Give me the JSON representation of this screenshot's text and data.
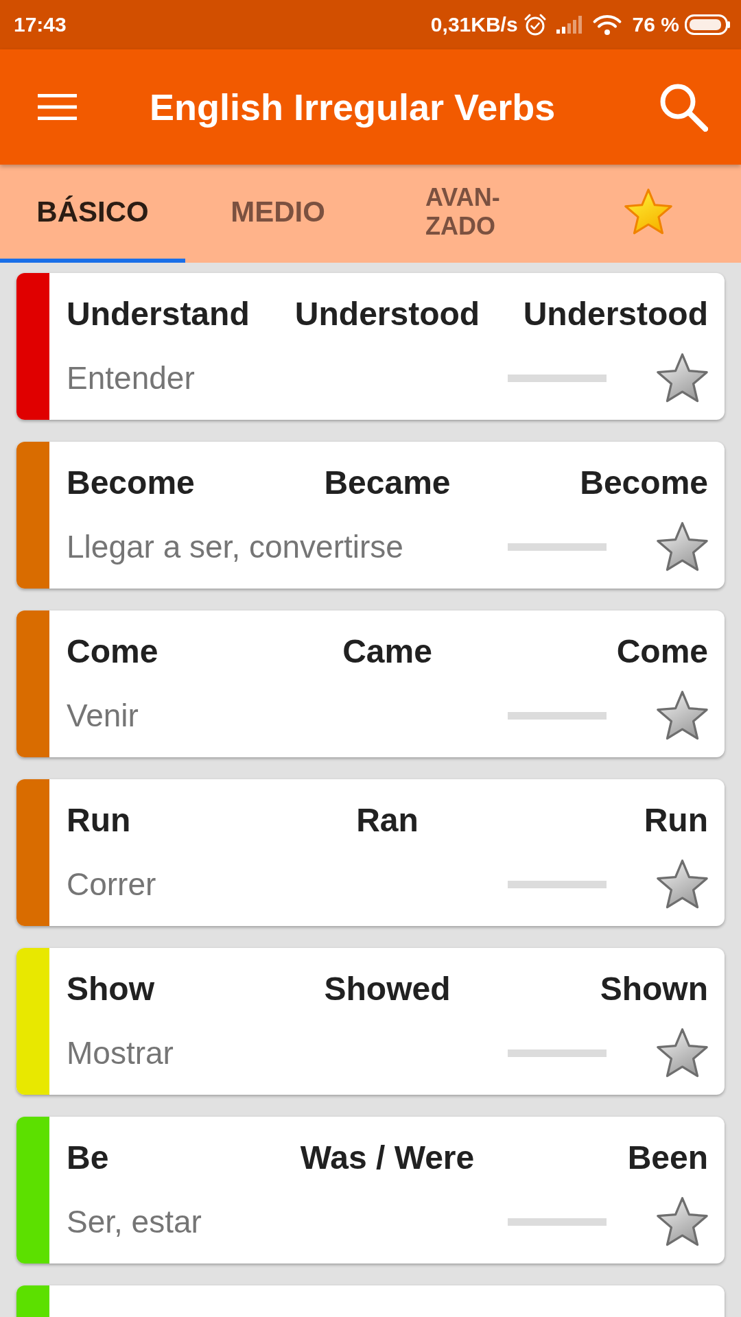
{
  "status_bar": {
    "time": "17:43",
    "network_speed": "0,31KB/s",
    "battery": "76 %"
  },
  "app_bar": {
    "title": "English Irregular Verbs"
  },
  "tabs": [
    {
      "kind": "text",
      "label": "BÁSICO",
      "selected": true
    },
    {
      "kind": "text",
      "label": "MEDIO",
      "selected": false
    },
    {
      "kind": "text",
      "label": "AVAN-ZADO",
      "selected": false
    },
    {
      "kind": "favorites",
      "selected": false
    }
  ],
  "verbs": [
    {
      "color": "#e00000",
      "forms": [
        "Understand",
        "Understood",
        "Understood"
      ],
      "translation": "Entender",
      "level": 0,
      "favorite": false
    },
    {
      "color": "#d96c00",
      "forms": [
        "Become",
        "Became",
        "Become"
      ],
      "translation": "Llegar a ser, convertirse",
      "level": 0,
      "favorite": false
    },
    {
      "color": "#d96c00",
      "forms": [
        "Come",
        "Came",
        "Come"
      ],
      "translation": "Venir",
      "level": 0,
      "favorite": false
    },
    {
      "color": "#d96c00",
      "forms": [
        "Run",
        "Ran",
        "Run"
      ],
      "translation": "Correr",
      "level": 0,
      "favorite": false
    },
    {
      "color": "#e8e800",
      "forms": [
        "Show",
        "Showed",
        "Shown"
      ],
      "translation": "Mostrar",
      "level": 0,
      "favorite": false
    },
    {
      "color": "#5ce000",
      "forms": [
        "Be",
        "Was / Were",
        "Been"
      ],
      "translation": "Ser, estar",
      "level": 0,
      "favorite": false
    },
    {
      "color": "#5ce000"
    }
  ]
}
